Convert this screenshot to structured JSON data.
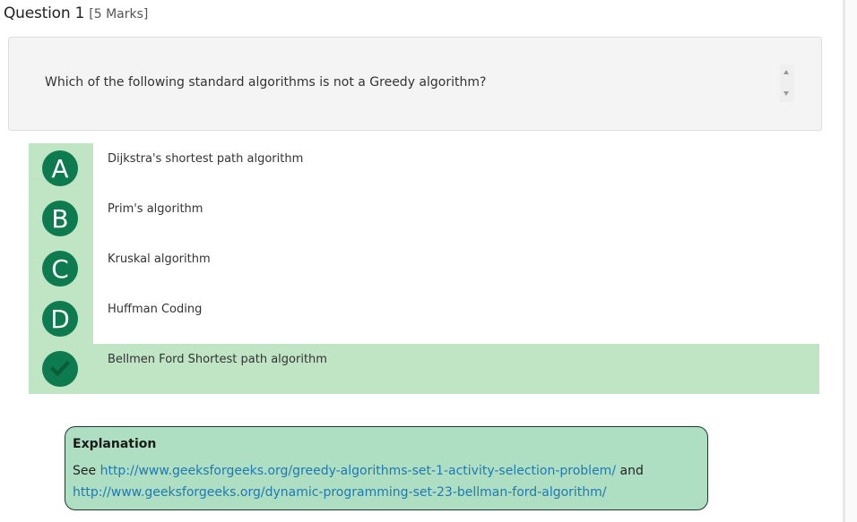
{
  "question": {
    "title": "Question 1",
    "marks": "[5 Marks]",
    "text": "Which of the following standard algorithms is not a Greedy algorithm?"
  },
  "options": [
    {
      "letter": "A",
      "label": "Dijkstra's shortest path algorithm",
      "correct": false
    },
    {
      "letter": "B",
      "label": "Prim's algorithm",
      "correct": false
    },
    {
      "letter": "C",
      "label": "Kruskal algorithm",
      "correct": false
    },
    {
      "letter": "D",
      "label": "Huffman Coding",
      "correct": false
    },
    {
      "letter": "",
      "label": "Bellmen Ford Shortest path algorithm",
      "correct": true,
      "icon": "check-icon"
    }
  ],
  "explanation": {
    "title": "Explanation",
    "prefix": "See ",
    "link1": "http://www.geeksforgeeks.org/greedy-algorithms-set-1-activity-selection-problem/",
    "conjunction": " and ",
    "link2": "http://www.geeksforgeeks.org/dynamic-programming-set-23-bellman-ford-algorithm/"
  },
  "colors": {
    "accent": "#0d7a4f",
    "highlight": "#c0e5c5",
    "explanation_bg": "#aedfc2",
    "link": "#1f78b4"
  }
}
